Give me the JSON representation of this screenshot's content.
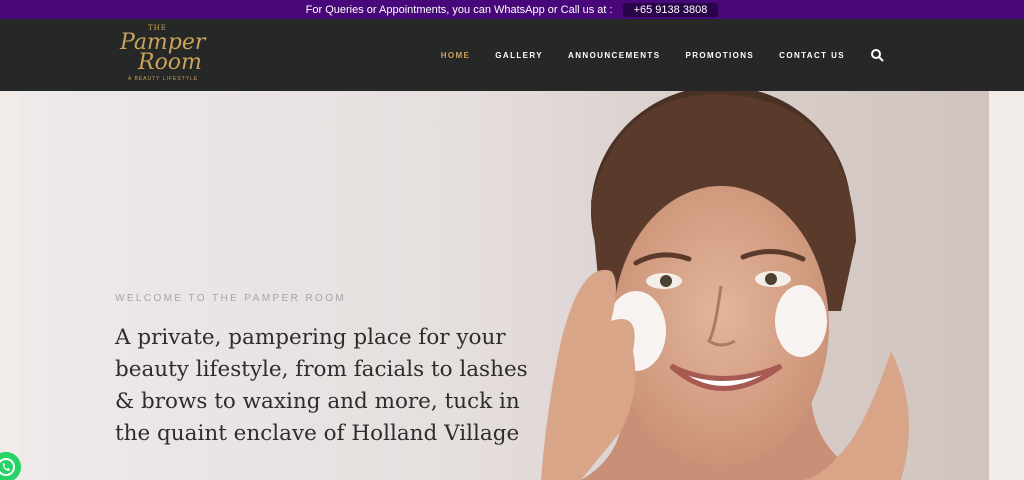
{
  "topbar": {
    "message": "For Queries or Appointments, you can WhatsApp or Call us at :",
    "phone": "+65 9138 3808"
  },
  "logo": {
    "the": "THE",
    "pamper": "Pamper",
    "room": "Room",
    "tagline": "A BEAUTY LIFESTYLE"
  },
  "nav": {
    "items": [
      {
        "label": "HOME"
      },
      {
        "label": "GALLERY"
      },
      {
        "label": "ANNOUNCEMENTS"
      },
      {
        "label": "PROMOTIONS"
      },
      {
        "label": "CONTACT US"
      }
    ],
    "search_icon": "search-icon"
  },
  "hero": {
    "welcome": "WELCOME TO THE PAMPER ROOM",
    "headline": "A private, pampering place for your beauty lifestyle, from facials to lashes & brows to waxing and more, tuck in the quaint enclave of Holland Village"
  },
  "colors": {
    "topbar": "#48087a",
    "navbar": "#252826",
    "gold": "#c9a25b",
    "whatsapp": "#25d366"
  }
}
